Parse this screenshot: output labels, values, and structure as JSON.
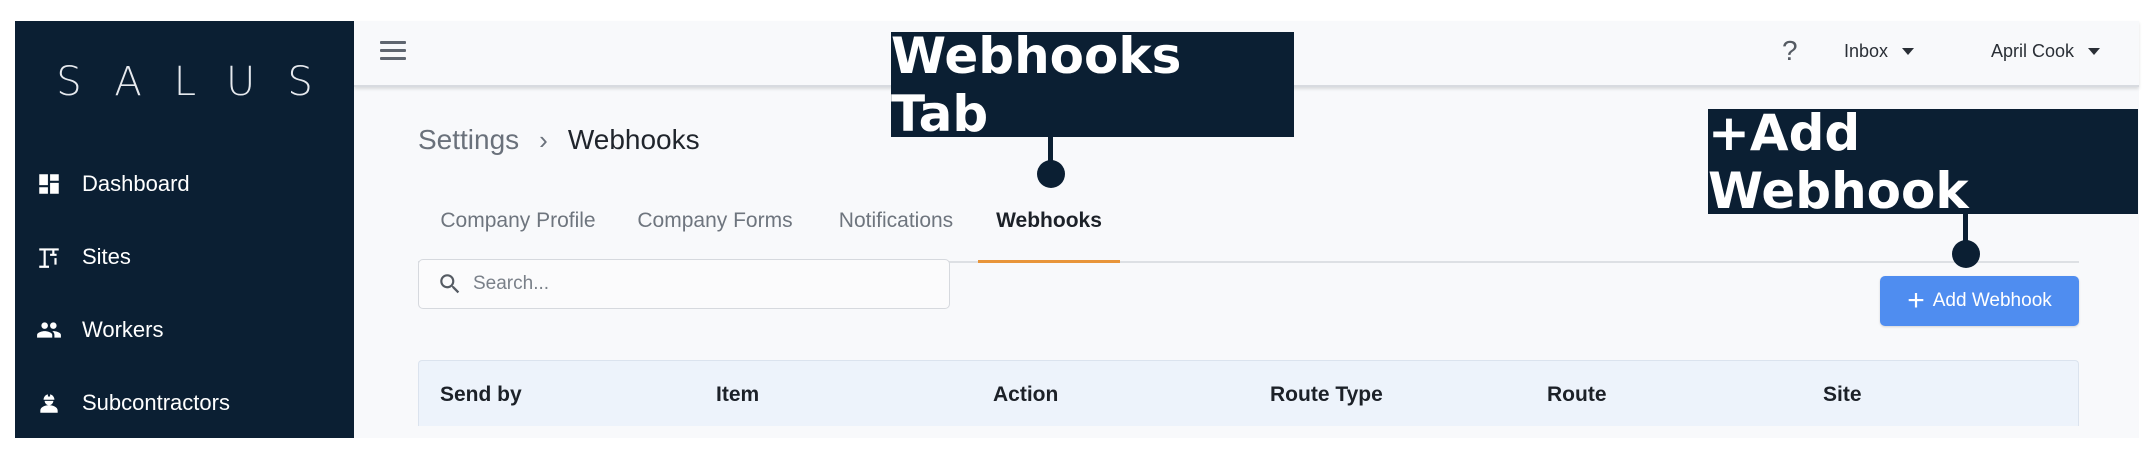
{
  "sidebar": {
    "logo": "SALUS",
    "items": [
      {
        "label": "Dashboard",
        "icon": "dashboard-icon"
      },
      {
        "label": "Sites",
        "icon": "crane-icon"
      },
      {
        "label": "Workers",
        "icon": "people-icon"
      },
      {
        "label": "Subcontractors",
        "icon": "engineer-icon"
      }
    ]
  },
  "topbar": {
    "help": "?",
    "inbox_label": "Inbox",
    "user_name": "April Cook"
  },
  "breadcrumb": {
    "root": "Settings",
    "separator": "›",
    "current": "Webhooks"
  },
  "tabs": [
    {
      "label": "Company Profile",
      "active": false
    },
    {
      "label": "Company Forms",
      "active": false
    },
    {
      "label": "Notifications",
      "active": false
    },
    {
      "label": "Webhooks",
      "active": true
    }
  ],
  "search": {
    "placeholder": "Search..."
  },
  "add_button": {
    "label": "Add Webhook",
    "color": "#4f8df0"
  },
  "table": {
    "columns": [
      "Send by",
      "Item",
      "Action",
      "Route Type",
      "Route",
      "Site"
    ]
  },
  "callouts": {
    "tab": "Webhooks Tab",
    "button": "+Add Webhook"
  },
  "colors": {
    "sidebar_bg": "#0b1f33",
    "active_tab_underline": "#e8953a",
    "header_row_bg": "#edf3fb"
  }
}
